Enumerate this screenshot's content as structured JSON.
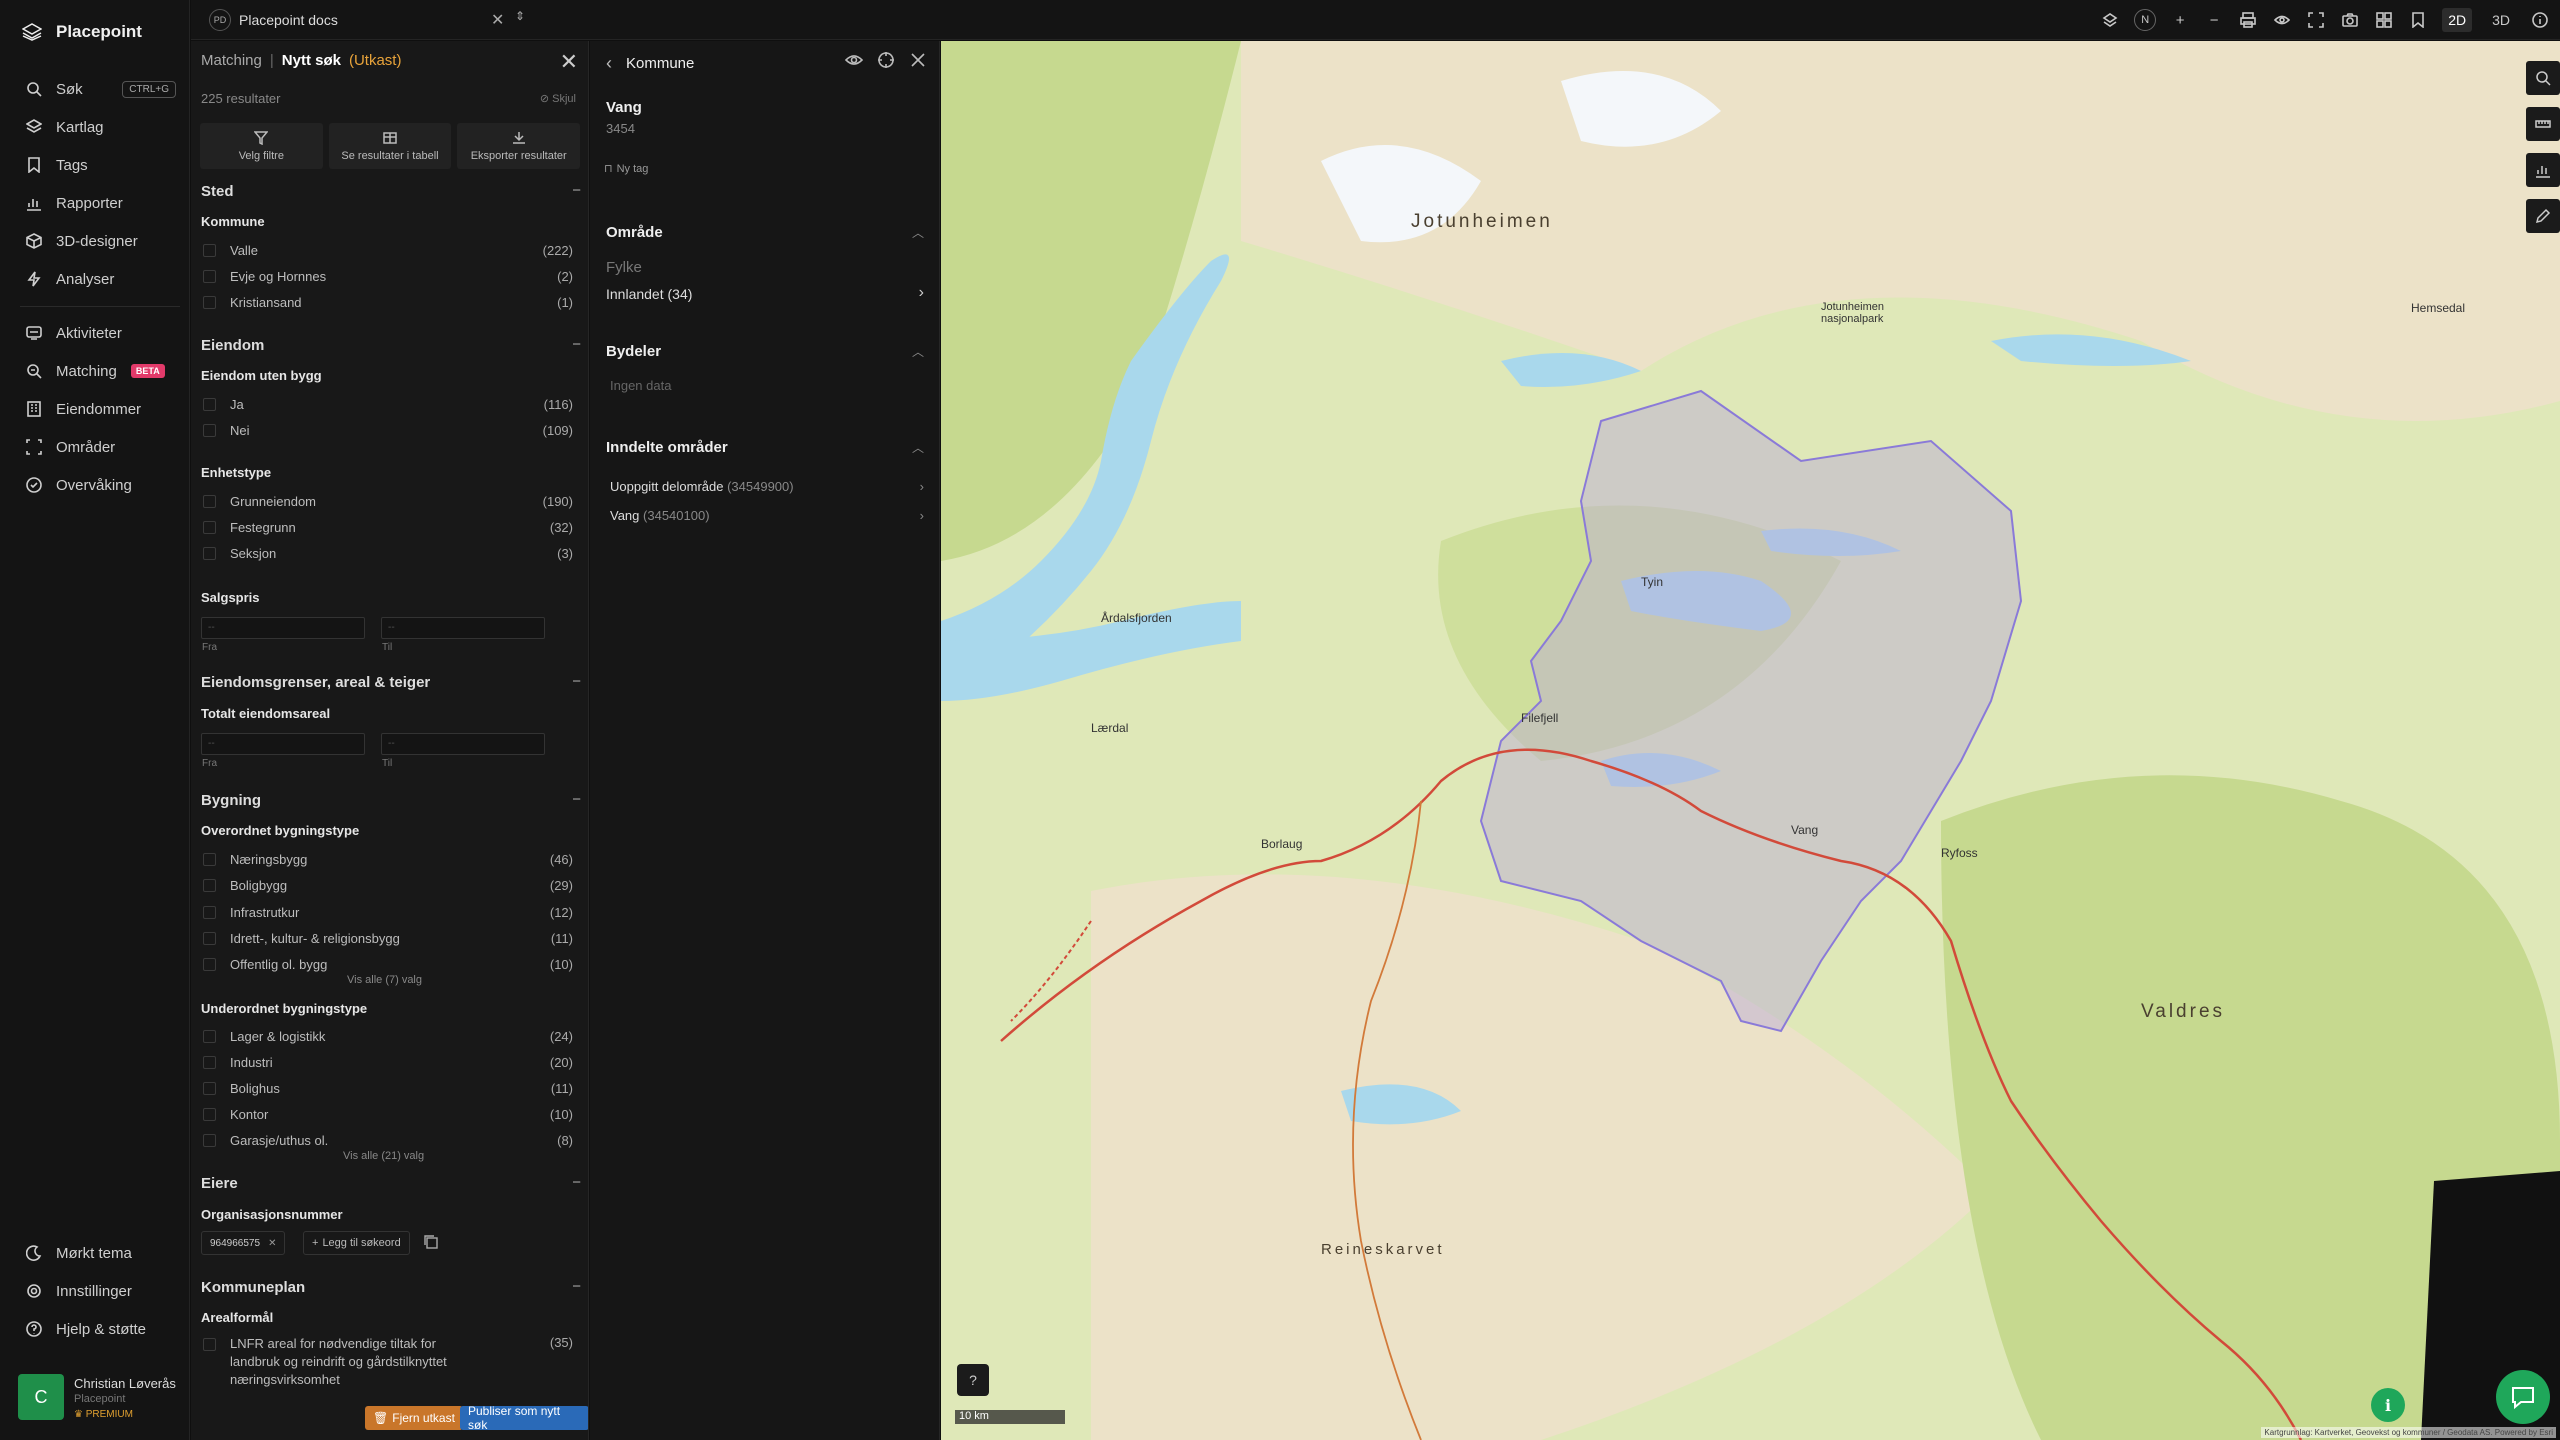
{
  "app": {
    "name": "Placepoint"
  },
  "nav": {
    "items": [
      {
        "label": "Søk",
        "shortcut": "CTRL+G"
      },
      {
        "label": "Kartlag"
      },
      {
        "label": "Tags"
      },
      {
        "label": "Rapporter"
      },
      {
        "label": "3D-designer"
      },
      {
        "label": "Analyser"
      },
      {
        "label": "Aktiviteter"
      },
      {
        "label": "Matching",
        "badge": "BETA"
      },
      {
        "label": "Eiendommer"
      },
      {
        "label": "Områder"
      },
      {
        "label": "Overvåking"
      }
    ],
    "bottom": [
      {
        "label": "Mørkt tema"
      },
      {
        "label": "Innstillinger"
      },
      {
        "label": "Hjelp & støtte"
      }
    ],
    "user": {
      "initial": "C",
      "name": "Christian Løverås",
      "org": "Placepoint",
      "plan": "PREMIUM"
    }
  },
  "topbar": {
    "doc_badge": "PD",
    "doc_title": "Placepoint docs",
    "compass": "N",
    "mode_2d": "2D",
    "mode_3d": "3D"
  },
  "filter": {
    "crumb": "Matching",
    "title": "Nytt søk",
    "draft": "(Utkast)",
    "results": "225 resultater",
    "hide": "Skjul",
    "actions": [
      "Velg filtre",
      "Se resultater i tabell",
      "Eksporter resultater"
    ],
    "sted": {
      "title": "Sted",
      "kommune_label": "Kommune",
      "kommune": [
        {
          "label": "Valle",
          "count": "(222)"
        },
        {
          "label": "Evje og Hornnes",
          "count": "(2)"
        },
        {
          "label": "Kristiansand",
          "count": "(1)"
        }
      ]
    },
    "eiendom": {
      "title": "Eiendom",
      "uten_bygg_label": "Eiendom uten bygg",
      "uten_bygg": [
        {
          "label": "Ja",
          "count": "(116)"
        },
        {
          "label": "Nei",
          "count": "(109)"
        }
      ],
      "enhetstype_label": "Enhetstype",
      "enhetstype": [
        {
          "label": "Grunneiendom",
          "count": "(190)"
        },
        {
          "label": "Festegrunn",
          "count": "(32)"
        },
        {
          "label": "Seksjon",
          "count": "(3)"
        }
      ],
      "salgspris_label": "Salgspris",
      "from": "Fra",
      "to": "Til",
      "placeholder": "--"
    },
    "grenser": {
      "title": "Eiendomsgrenser, areal & teiger",
      "areal_label": "Totalt eiendomsareal",
      "from": "Fra",
      "to": "Til",
      "placeholder": "--"
    },
    "bygning": {
      "title": "Bygning",
      "over_label": "Overordnet bygningstype",
      "over": [
        {
          "label": "Næringsbygg",
          "count": "(46)"
        },
        {
          "label": "Boligbygg",
          "count": "(29)"
        },
        {
          "label": "Infrastrutkur",
          "count": "(12)"
        },
        {
          "label": "Idrett-, kultur- & religionsbygg",
          "count": "(11)"
        },
        {
          "label": "Offentlig ol. bygg",
          "count": "(10)"
        }
      ],
      "over_more": "Vis alle (7) valg",
      "under_label": "Underordnet bygningstype",
      "under": [
        {
          "label": "Lager & logistikk",
          "count": "(24)"
        },
        {
          "label": "Industri",
          "count": "(20)"
        },
        {
          "label": "Bolighus",
          "count": "(11)"
        },
        {
          "label": "Kontor",
          "count": "(10)"
        },
        {
          "label": "Garasje/uthus ol.",
          "count": "(8)"
        }
      ],
      "under_more": "Vis alle (21) valg"
    },
    "eiere": {
      "title": "Eiere",
      "org_label": "Organisasjonsnummer",
      "org_chip": "964966575",
      "add_label": "Legg til søkeord"
    },
    "kommuneplan": {
      "title": "Kommuneplan",
      "areal_label": "Arealformål",
      "item": "LNFR areal for nødvendige tiltak for landbruk og reindrift og gårdstilknyttet næringsvirksomhet",
      "count": "(35)"
    },
    "btn_remove": "Fjern utkast",
    "btn_publish": "Publiser som nytt søk"
  },
  "detail": {
    "header": "Kommune",
    "name": "Vang",
    "number": "3454",
    "tag": "Ny tag",
    "omrade_title": "Område",
    "fylke_label": "Fylke",
    "fylke_value": "Innlandet (34)",
    "bydeler_title": "Bydeler",
    "bydeler_empty": "Ingen data",
    "inndelte_title": "Inndelte områder",
    "inndelte": [
      {
        "label": "Uoppgitt delområde",
        "id": "(34549900)"
      },
      {
        "label": "Vang",
        "id": "(34540100)"
      }
    ]
  },
  "map": {
    "scale": "10 km",
    "help": "?",
    "info": "i",
    "attribution": "Kartgrunnlag: Kartverket, Geovekst og kommuner / Geodata AS. Powered by Esri",
    "labels": [
      {
        "text": "Jotunheimen",
        "big": true
      },
      {
        "text": "Valdres",
        "big": true
      },
      {
        "text": "Tyin"
      },
      {
        "text": "Vang"
      },
      {
        "text": "Filefjell"
      },
      {
        "text": "Borlaug"
      },
      {
        "text": "Ryfoss"
      },
      {
        "text": "Hemsedal"
      },
      {
        "text": "Jotunheimen nasjonalpark"
      },
      {
        "text": "Årdalsfjorden"
      },
      {
        "text": "Lærdal"
      },
      {
        "text": "Reineskarvet"
      }
    ],
    "colors": {
      "land": "#dfe8b8",
      "water": "#a9d8ec",
      "forest": "#c6d98f",
      "highland": "#ece2c8",
      "region": "#b8a8d8",
      "road": "#d24a3a"
    }
  }
}
